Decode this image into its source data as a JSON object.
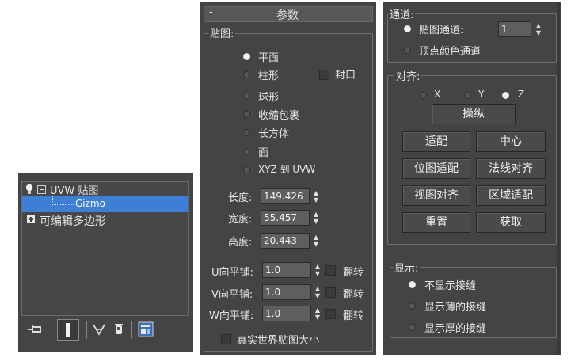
{
  "stack": {
    "modifier": "UVW 贴图",
    "subobject": "Gizmo",
    "base": "可编辑多边形"
  },
  "params": {
    "header": "参数",
    "collapse_glyph": "-",
    "mapping_title": "贴图:",
    "types": [
      "平面",
      "柱形",
      "球形",
      "收缩包裹",
      "长方体",
      "面",
      "XYZ 到 UVW"
    ],
    "selected_type": "平面",
    "cap_label": "封口",
    "length_label": "长度:",
    "length_value": "149.426",
    "width_label": "宽度:",
    "width_value": "55.457",
    "height_label": "高度:",
    "height_value": "20.443",
    "u_tile_label": "U向平铺:",
    "u_tile_value": "1.0",
    "v_tile_label": "V向平铺:",
    "v_tile_value": "1.0",
    "w_tile_label": "W向平铺:",
    "w_tile_value": "1.0",
    "flip_label": "翻转",
    "real_world_label": "真实世界贴图大小"
  },
  "channel": {
    "title": "通道:",
    "map_channel_label": "贴图通道:",
    "map_channel_value": "1",
    "vertex_color_label": "顶点颜色通道"
  },
  "alignment": {
    "title": "对齐:",
    "axes": [
      "X",
      "Y",
      "Z"
    ],
    "selected_axis": "Z",
    "manipulate": "操纵",
    "buttons": [
      "适配",
      "中心",
      "位图适配",
      "法线对齐",
      "视图对齐",
      "区域适配",
      "重置",
      "获取"
    ]
  },
  "display": {
    "title": "显示:",
    "options": [
      "不显示接缝",
      "显示薄的接缝",
      "显示厚的接缝"
    ],
    "selected": "不显示接缝"
  },
  "colors": {
    "panel": "#444444",
    "selection": "#3d7fd6",
    "field": "#5e5e5e"
  }
}
